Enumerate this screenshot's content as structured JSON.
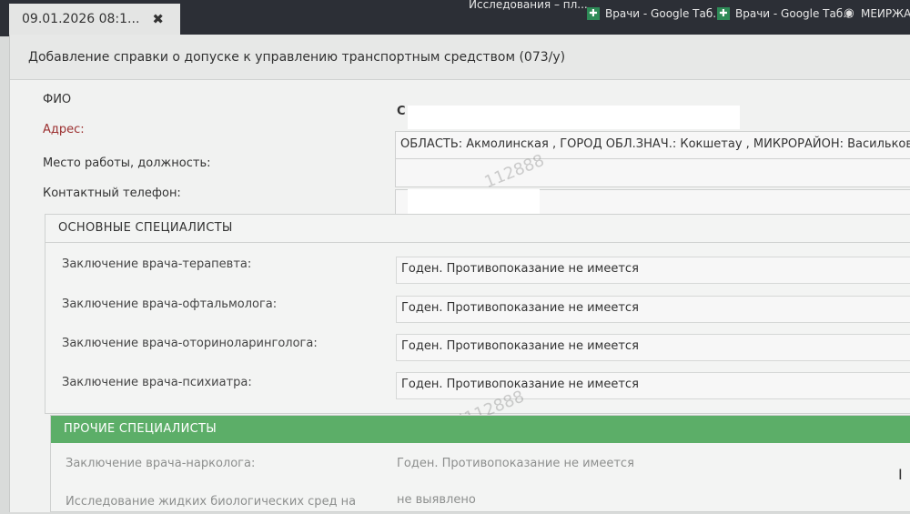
{
  "browser": {
    "tab_title": "09.01.2026 08:1...",
    "tab_close": "✖",
    "bookmarks": [
      {
        "label": "Исследования – пл..."
      },
      {
        "label": "Врачи - Google Таб..."
      },
      {
        "label": "Врачи - Google Таб..."
      },
      {
        "label": "МЕИРЖАНУ..."
      }
    ]
  },
  "dialog": {
    "title": "Добавление справки о допуске к управлению транспортным средством (073/у)"
  },
  "patient": {
    "fio_label": "ФИО",
    "fio_value": "С",
    "address_label": "Адрес:",
    "address_value": "ОБЛАСТЬ: Акмолинская , ГОРОД ОБЛ.ЗНАЧ.: Кокшетау , МИКРОРАЙОН: Васильковский ,",
    "work_label": "Место работы, должность:",
    "work_value": "",
    "phone_label": "Контактный телефон:",
    "phone_value": ""
  },
  "main_specialists": {
    "title": "ОСНОВНЫЕ СПЕЦИАЛИСТЫ",
    "rows": [
      {
        "label": "Заключение врача-терапевта:",
        "value": "Годен. Противопоказание не имеется"
      },
      {
        "label": "Заключение врача-офтальмолога:",
        "value": "Годен. Противопоказание не имеется"
      },
      {
        "label": "Заключение врача-оториноларинголога:",
        "value": "Годен. Противопоказание не имеется"
      },
      {
        "label": "Заключение врача-психиатра:",
        "value": "Годен. Противопоказание не имеется"
      }
    ]
  },
  "other_specialists": {
    "title": "ПРОЧИЕ СПЕЦИАЛИСТЫ",
    "rows": [
      {
        "label": "Заключение врача-нарколога:",
        "value": "Годен. Противопоказание не имеется"
      },
      {
        "label": "Исследование жидких биологических сред на",
        "value": "не выявлено"
      }
    ]
  },
  "watermarks": [
    "112888",
    "16|112888"
  ],
  "colors": {
    "section_green": "#5cae68",
    "address_label": "#9b2f2f"
  }
}
